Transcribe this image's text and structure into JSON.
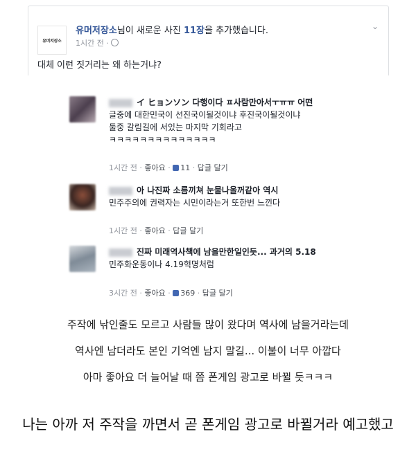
{
  "post": {
    "page_logo_text": "유머저장소",
    "page_name": "유머저장소",
    "header_mid": "님이 새로운 사진 ",
    "photo_count": "11장",
    "header_end": "을 추가했습니다.",
    "time": "1시간 전 ·",
    "text": "대체 이런 짓거리는 왜 하는거냐?"
  },
  "comments": [
    {
      "lines": [
        "イ ヒョンソン 다행이다 ㅍ사람만아서ㅜㅠㅠ 어떤",
        "글중에 대한민국이 선진국이될것이냐 후진국이될것이냐",
        "둘중 갈림길에 서있는 마지막 기회라고",
        "ㅋㅋㅋㅋㅋㅋㅋㅋㅋㅋㅋㅋㅋㅋ"
      ],
      "time": "1시간 전",
      "like": "좋아요",
      "likes": "11",
      "reply": "답글 달기"
    },
    {
      "lines": [
        "아 나진짜 소름끼쳐 눈물나올꺼같아 역시",
        "민주주의에 권력자는 시민이라는거 또한번 느낀다"
      ],
      "time": "1시간 전",
      "like": "좋아요",
      "reply": "답글 달기"
    },
    {
      "lines": [
        "진짜 미래역사책에 남을만한일인듯... 과거의 5.18",
        "민주화운동이나 4.19혁명처럼"
      ],
      "time": "3시간 전",
      "like": "좋아요",
      "likes": "369",
      "reply": "답글 달기"
    }
  ],
  "captions": [
    "주작에 낚인줄도 모르고 사람들 많이 왔다며 역사에 남을거라는데",
    "역사엔 남더라도 본인 기억엔 남지 말길... 이불이 너무 아깝다",
    "아마 좋아요 더 늘어날 때 쯤 폰게임 광고로 바뀔 듯ㅋㅋㅋ"
  ],
  "footer_caption": "나는 아까 저 주작을 까면서 곧 폰게임 광고로 바뀔거라 예고했고"
}
